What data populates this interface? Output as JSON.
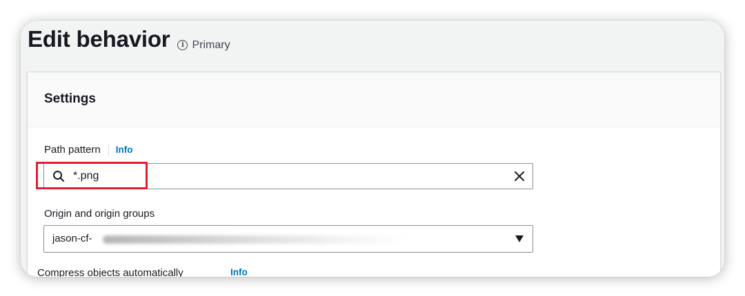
{
  "header": {
    "title": "Edit behavior",
    "badge_label": "Primary"
  },
  "settings": {
    "title": "Settings",
    "path_pattern": {
      "label": "Path pattern",
      "info": "Info",
      "value": "*.png"
    },
    "origin": {
      "label": "Origin and origin groups",
      "value": "jason-cf-"
    },
    "next_field": {
      "label": "Compress objects automatically",
      "info": "Info"
    }
  },
  "colors": {
    "accent": "#0073bb",
    "highlight": "#e11d2e"
  }
}
